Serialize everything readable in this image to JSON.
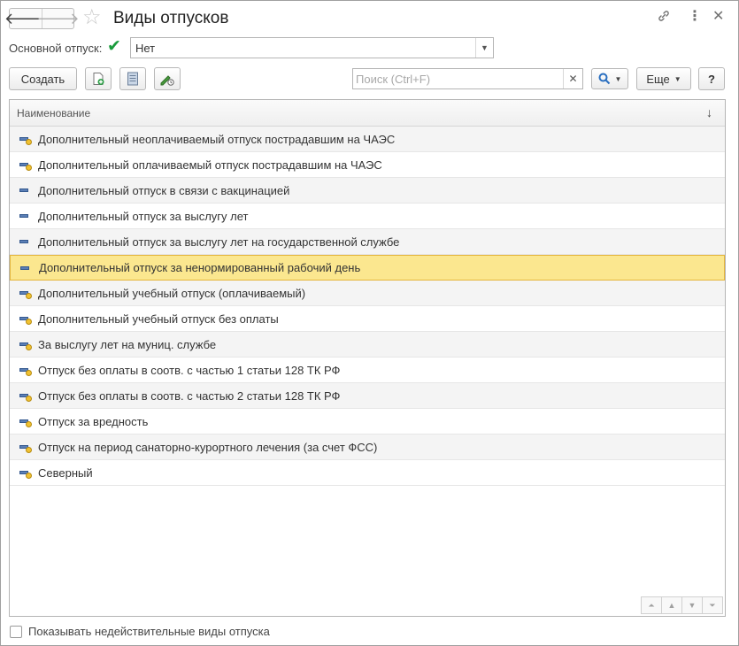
{
  "window": {
    "title": "Виды отпусков",
    "icons": {
      "back": "arrow-left-icon",
      "forward": "arrow-right-icon",
      "favorite": "star-icon",
      "link": "link-icon",
      "menu": "more-vertical-icon",
      "close": "close-icon"
    }
  },
  "filter": {
    "label": "Основной отпуск:",
    "checked": true,
    "value": "Нет"
  },
  "toolbar": {
    "create_label": "Создать",
    "search_placeholder": "Поиск (Ctrl+F)",
    "more_label": "Еще",
    "help_label": "?"
  },
  "table": {
    "column_header": "Наименование",
    "selected_index": 5,
    "rows": [
      {
        "name": "Дополнительный неоплачиваемый отпуск пострадавшим на ЧАЭС",
        "badge": true
      },
      {
        "name": "Дополнительный оплачиваемый отпуск пострадавшим на ЧАЭС",
        "badge": true
      },
      {
        "name": "Дополнительный отпуск в связи с вакцинацией",
        "badge": false
      },
      {
        "name": "Дополнительный отпуск за выслугу лет",
        "badge": false
      },
      {
        "name": "Дополнительный отпуск за выслугу лет на государственной службе",
        "badge": false
      },
      {
        "name": "Дополнительный отпуск за ненормированный рабочий день",
        "badge": false
      },
      {
        "name": "Дополнительный учебный отпуск (оплачиваемый)",
        "badge": true
      },
      {
        "name": "Дополнительный учебный отпуск без оплаты",
        "badge": true
      },
      {
        "name": "За выслугу лет на муниц. службе",
        "badge": true
      },
      {
        "name": "Отпуск без оплаты в соотв. с частью 1 статьи 128 ТК РФ",
        "badge": true
      },
      {
        "name": "Отпуск без оплаты в соотв. с частью 2 статьи 128 ТК РФ",
        "badge": true
      },
      {
        "name": "Отпуск за вредность",
        "badge": true
      },
      {
        "name": "Отпуск на период санаторно-курортного лечения (за счет ФСС)",
        "badge": true
      },
      {
        "name": "Северный",
        "badge": true
      }
    ]
  },
  "footer": {
    "show_invalid_label": "Показывать недействительные виды отпуска",
    "show_invalid_checked": false
  },
  "colors": {
    "selected_row": "#fbe78f",
    "selected_border": "#e4b53b",
    "checkmark": "#1a9b3c"
  }
}
